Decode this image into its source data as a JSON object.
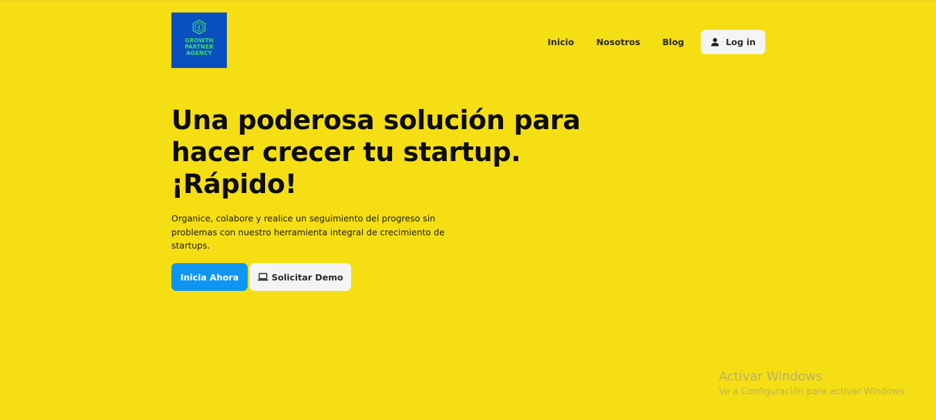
{
  "brand": {
    "logo_lines": [
      "GROWTH",
      "PARTNER",
      "AGENCY"
    ],
    "logo_bg": "#0a4fbf",
    "logo_text_color": "#3fdc6a",
    "logo_icon": "hexagon-rocket-icon"
  },
  "nav": {
    "items": [
      {
        "label": "Inicio"
      },
      {
        "label": "Nosotros"
      },
      {
        "label": "Blog"
      }
    ],
    "login_label": "Log in",
    "login_icon": "user-icon"
  },
  "hero": {
    "title_lines": [
      "Una poderosa solución para",
      "hacer crecer tu startup.",
      "¡Rápido!"
    ],
    "description": "Organice, colabore y realice un seguimiento del progreso sin problemas con nuestro herramienta integral de crecimiento de startups.",
    "primary_cta": "Inicia Ahora",
    "secondary_cta": "Solicitar Demo",
    "secondary_icon": "laptop-icon"
  },
  "watermark": {
    "title": "Activar Windows",
    "subtitle": "Ve a Configuración para activar Windows."
  },
  "colors": {
    "background": "#f6de14",
    "primary_button": "#0f96f2",
    "secondary_button": "#f4f4f5"
  }
}
